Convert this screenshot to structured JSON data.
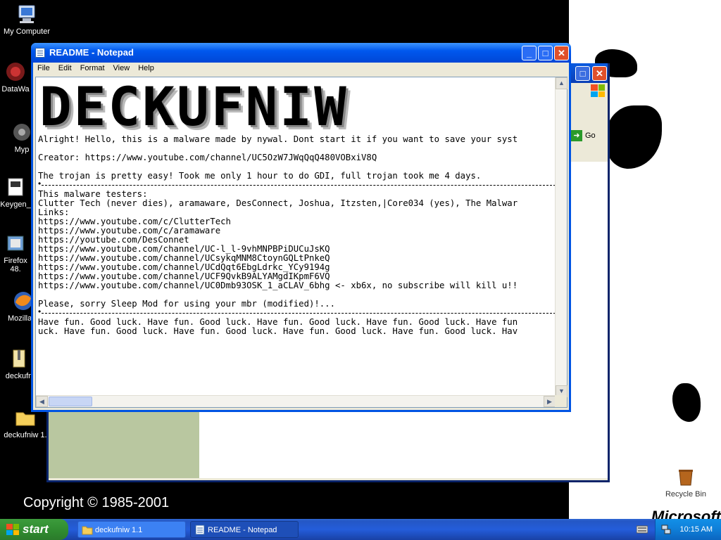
{
  "desktop": {
    "icons": [
      {
        "label": "My Computer"
      },
      {
        "label": "DataWa"
      },
      {
        "label": "Myp"
      },
      {
        "label": "Keygen_"
      },
      {
        "label": "Firefox"
      },
      {
        "label": "48."
      },
      {
        "label": "Mozilla F"
      },
      {
        "label": "deckufn"
      },
      {
        "label": "deckufniw 1."
      },
      {
        "label": "Recycle Bin"
      }
    ],
    "copyright": "Copyright © 1985-2001",
    "brand": "Microsoft"
  },
  "explorer": {
    "go_label": "Go"
  },
  "notepad": {
    "title": "README - Notepad",
    "menu": [
      "File",
      "Edit",
      "Format",
      "View",
      "Help"
    ],
    "banner": "DECKUFNIW",
    "lines": [
      "Alright! Hello, this is a malware made by nywal. Dont start it if you want to save your syst",
      "",
      "Creator: https://www.youtube.com/channel/UC5OzW7JWqQqQ480VOBxiV8Q",
      "",
      "The trojan is pretty easy! Took me only 1 hour to do GDI, full trojan took me 4 days.",
      "---",
      "This malware testers:",
      "Clutter Tech (never dies), aramaware, DesConnect, Joshua, Itzsten,|Core034 (yes), The Malwar",
      "Links:",
      "https://www.youtube.com/c/ClutterTech",
      "https://www.youtube.com/c/aramaware",
      "https://youtube.com/DesConnet",
      "https://www.youtube.com/channel/UC-l_l-9vhMNPBPiDUCuJsKQ",
      "https://www.youtube.com/channel/UCsykqMNM8CtoynGQLtPnkeQ",
      "https://www.youtube.com/channel/UCdQqt6EbgLdrkc_YCy9194g",
      "https://www.youtube.com/channel/UCF9QvkB9ALYAMgdIKpmF6VQ",
      "https://www.youtube.com/channel/UC0Dmb93OSK_1_aCLAV_6bhg <- xb6x, no subscribe will kill u!!",
      "",
      "Please, sorry Sleep Mod for using your mbr (modified)!...",
      "---",
      "Have fun. Good luck. Have fun. Good luck. Have fun. Good luck. Have fun. Good luck. Have fun",
      "uck. Have fun. Good luck. Have fun. Good luck. Have fun. Good luck. Have fun. Good luck. Hav"
    ]
  },
  "taskbar": {
    "start_label": "start",
    "tasks": [
      {
        "label": "deckufniw 1.1"
      },
      {
        "label": "README - Notepad"
      }
    ],
    "clock": "10:15 AM"
  },
  "colors": {
    "title_blue": "#0058ee",
    "close_red": "#e0502a",
    "start_green": "#2f8a2f"
  }
}
